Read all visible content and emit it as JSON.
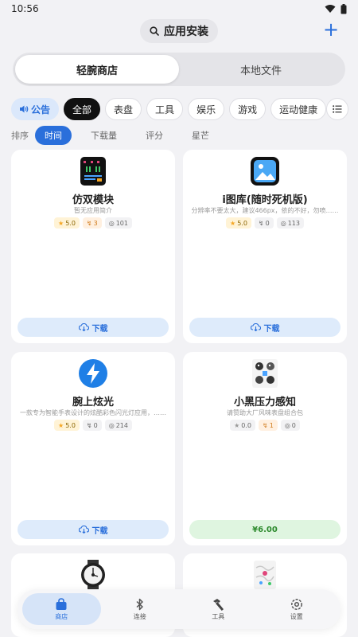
{
  "status_bar": {
    "time": "10:56"
  },
  "header": {
    "title": "应用安装",
    "add_symbol": "+"
  },
  "segments": [
    {
      "label": "轻腕商店",
      "active": true
    },
    {
      "label": "本地文件",
      "active": false
    }
  ],
  "chips": {
    "notice": "公告",
    "items": [
      {
        "label": "全部",
        "active": true
      },
      {
        "label": "表盘",
        "active": false
      },
      {
        "label": "工具",
        "active": false
      },
      {
        "label": "娱乐",
        "active": false
      },
      {
        "label": "游戏",
        "active": false
      },
      {
        "label": "运动健康",
        "active": false
      }
    ]
  },
  "sort": {
    "label": "排序",
    "options": [
      {
        "label": "时间",
        "active": true
      },
      {
        "label": "下载量",
        "active": false
      },
      {
        "label": "评分",
        "active": false
      },
      {
        "label": "星芒",
        "active": false
      }
    ]
  },
  "apps": [
    {
      "name": "仿双模块",
      "desc": "暂无应用简介",
      "rating": "5.0",
      "favs": "3",
      "downloads": "101",
      "action": "下载",
      "action_type": "download",
      "icon": "watch-face-icon"
    },
    {
      "name": "i图库(随时死机版)",
      "desc": "分辨率不要太大，建议466px，依的不好，勿喷……",
      "rating": "5.0",
      "favs": "0",
      "downloads": "113",
      "action": "下载",
      "action_type": "download",
      "icon": "image-gallery-icon"
    },
    {
      "name": "腕上炫光",
      "desc": "一款专为智能手表设计的炫酷彩色闪光灯应用，……",
      "rating": "5.0",
      "favs": "0",
      "downloads": "214",
      "action": "下载",
      "action_type": "download",
      "icon": "lightning-icon"
    },
    {
      "name": "小黑压力感知",
      "desc": "请赞助大厂风味表盘组合包",
      "rating": "0.0",
      "favs": "1",
      "downloads": "0",
      "action": "¥6.00",
      "action_type": "price",
      "icon": "sticker-pack-icon"
    },
    {
      "name": "",
      "desc": "",
      "rating": "",
      "favs": "",
      "downloads": "",
      "action": "",
      "action_type": "download",
      "icon": "round-watch-icon"
    },
    {
      "name": "",
      "desc": "",
      "rating": "",
      "favs": "",
      "downloads": "",
      "action": "",
      "action_type": "download",
      "icon": "map-sticker-icon"
    }
  ],
  "tabs": [
    {
      "label": "商店",
      "icon": "shopping-bag-icon",
      "active": true
    },
    {
      "label": "连接",
      "icon": "bluetooth-icon",
      "active": false
    },
    {
      "label": "工具",
      "icon": "hammer-icon",
      "active": false
    },
    {
      "label": "设置",
      "icon": "settings-icon",
      "active": false
    }
  ],
  "colors": {
    "accent": "#2a6fdb",
    "active_chip": "#111111",
    "price_green": "#2e8b2e"
  }
}
